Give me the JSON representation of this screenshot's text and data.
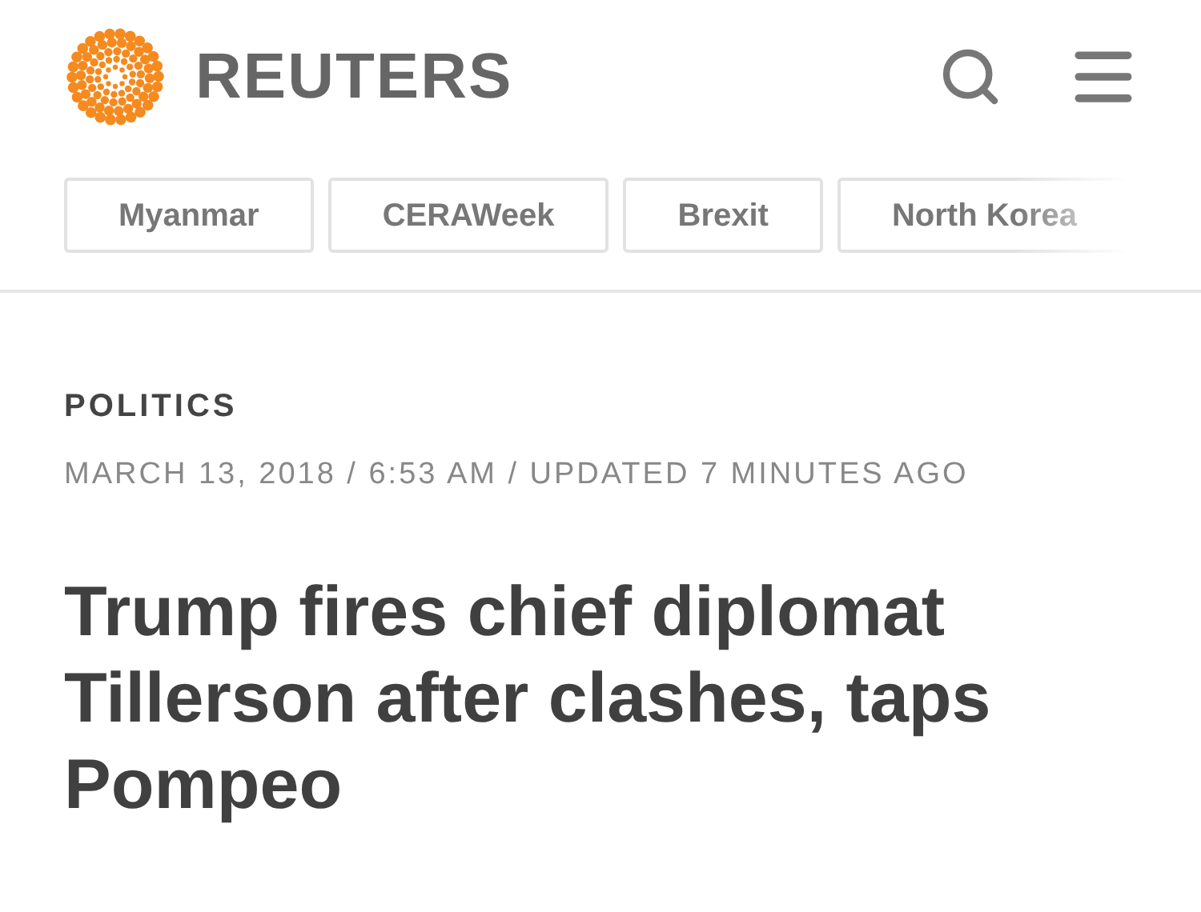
{
  "header": {
    "brand": "REUTERS"
  },
  "topics": [
    {
      "label": "Myanmar"
    },
    {
      "label": "CERAWeek"
    },
    {
      "label": "Brexit"
    },
    {
      "label": "North Korea"
    }
  ],
  "article": {
    "section": "POLITICS",
    "dateline": "MARCH 13, 2018 / 6:53 AM / UPDATED 7 MINUTES AGO",
    "headline": "Trump fires chief diplomat Tillerson after clashes, taps Pompeo"
  }
}
